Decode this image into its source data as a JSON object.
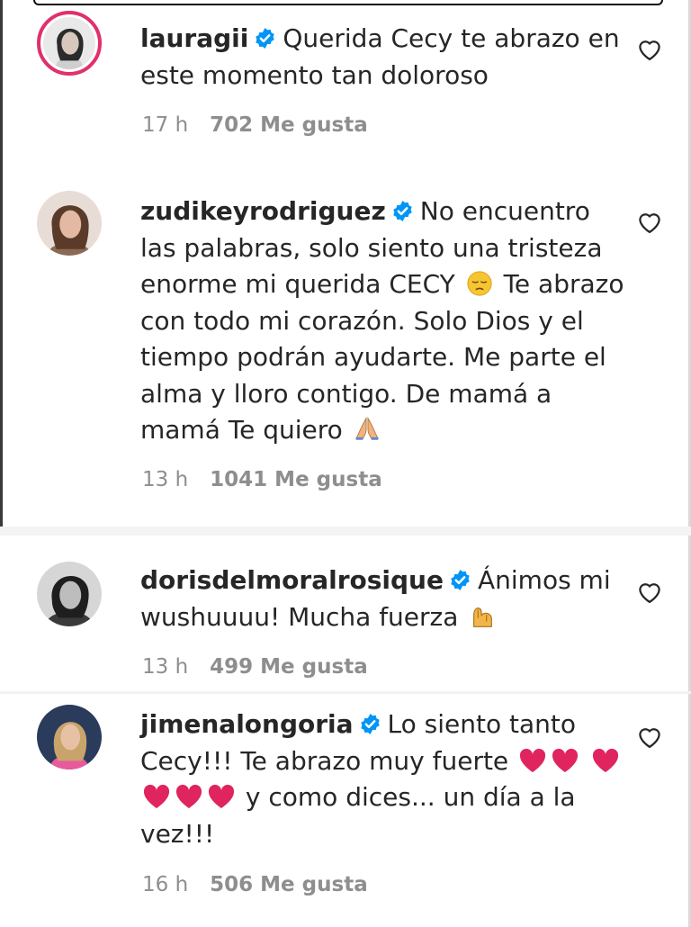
{
  "comments": [
    {
      "username": "lauragii",
      "text": "Querida Cecy te abrazo en este momento tan doloroso",
      "time": "17 h",
      "likes": "702 Me gusta",
      "avatar_icon": "profile-photo",
      "has_story_ring": true
    },
    {
      "username": "zudikeyrodriguez",
      "text_parts": [
        "No encuentro las palabras, solo siento una tristeza enorme mi querida CECY",
        "Te abrazo con todo mi corazón. Solo Dios y el tiempo podrán ayudarte. Me parte el alma y lloro contigo. De mamá a mamá Te quiero"
      ],
      "time": "13 h",
      "likes": "1041 Me gusta",
      "emojis": [
        "pensive-face",
        "folded-hands"
      ]
    },
    {
      "username": "dorisdelmoralrosique",
      "text": "Ánimos mi wushuuuu! Mucha fuerza",
      "time": "13 h",
      "likes": "499 Me gusta",
      "emojis": [
        "flexed-biceps"
      ]
    },
    {
      "username": "jimenalongoria",
      "text_parts": [
        "Lo siento tanto Cecy!!! Te abrazo muy fuerte",
        "y como dices... un día a la vez!!!"
      ],
      "time": "16 h",
      "likes": "506 Me gusta",
      "emojis": [
        "red-heart",
        "red-heart",
        "red-heart",
        "red-heart",
        "red-heart",
        "red-heart"
      ]
    }
  ],
  "colors": {
    "verified": "#0095f6",
    "meta_gray": "#8e8e8e",
    "heart_red": "#e0245e",
    "story_ring": "#e1306c"
  },
  "icons": {
    "verified": "verified-badge-icon",
    "like": "heart-outline-icon"
  }
}
